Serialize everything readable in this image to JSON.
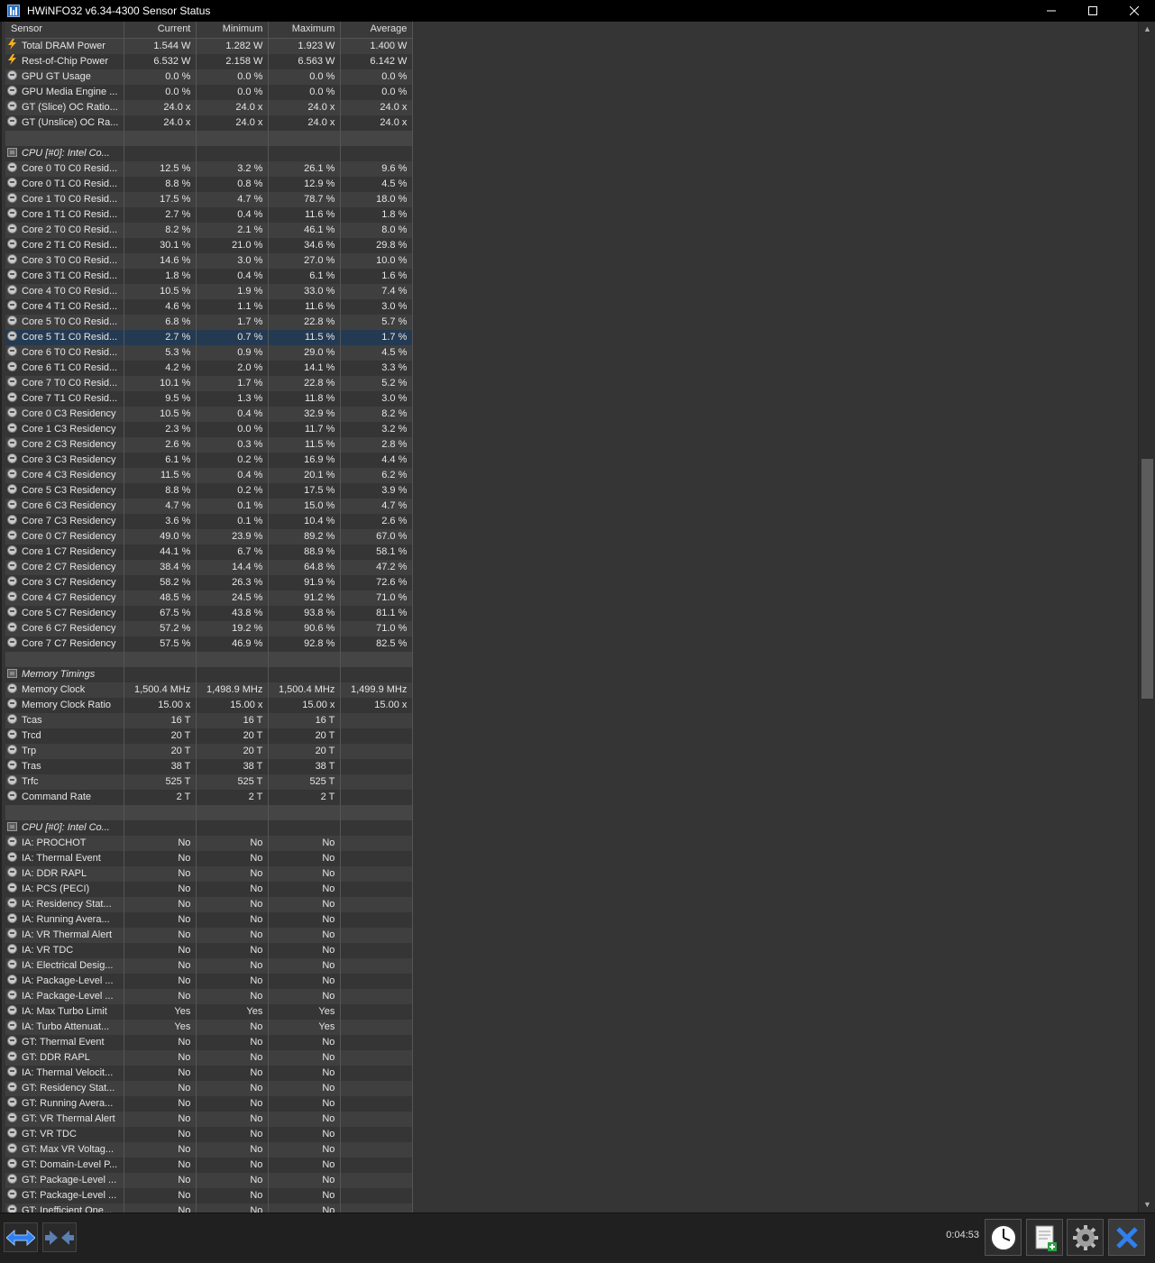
{
  "window": {
    "title": "HWiNFO32 v6.34-4300 Sensor Status",
    "minimize": "minimize",
    "maximize": "maximize",
    "close": "close"
  },
  "columns": [
    "Sensor",
    "Current",
    "Minimum",
    "Maximum",
    "Average"
  ],
  "rows": [
    {
      "icon": "bolt",
      "name": "Total DRAM Power",
      "vals": [
        "1.544 W",
        "1.282 W",
        "1.923 W",
        "1.400 W"
      ]
    },
    {
      "icon": "bolt",
      "name": "Rest-of-Chip Power",
      "vals": [
        "6.532 W",
        "2.158 W",
        "6.563 W",
        "6.142 W"
      ]
    },
    {
      "icon": "gauge",
      "name": "GPU GT Usage",
      "vals": [
        "0.0 %",
        "0.0 %",
        "0.0 %",
        "0.0 %"
      ]
    },
    {
      "icon": "gauge",
      "name": "GPU Media Engine ...",
      "vals": [
        "0.0 %",
        "0.0 %",
        "0.0 %",
        "0.0 %"
      ]
    },
    {
      "icon": "gauge",
      "name": "GT (Slice) OC Ratio...",
      "vals": [
        "24.0 x",
        "24.0 x",
        "24.0 x",
        "24.0 x"
      ]
    },
    {
      "icon": "gauge",
      "name": "GT (Unslice) OC Ra...",
      "vals": [
        "24.0 x",
        "24.0 x",
        "24.0 x",
        "24.0 x"
      ]
    },
    {
      "type": "empty"
    },
    {
      "type": "group",
      "icon": "chip",
      "name": "CPU [#0]: Intel Co..."
    },
    {
      "icon": "gauge",
      "name": "Core 0 T0 C0 Resid...",
      "vals": [
        "12.5 %",
        "3.2 %",
        "26.1 %",
        "9.6 %"
      ]
    },
    {
      "icon": "gauge",
      "name": "Core 0 T1 C0 Resid...",
      "vals": [
        "8.8 %",
        "0.8 %",
        "12.9 %",
        "4.5 %"
      ]
    },
    {
      "icon": "gauge",
      "name": "Core 1 T0 C0 Resid...",
      "vals": [
        "17.5 %",
        "4.7 %",
        "78.7 %",
        "18.0 %"
      ]
    },
    {
      "icon": "gauge",
      "name": "Core 1 T1 C0 Resid...",
      "vals": [
        "2.7 %",
        "0.4 %",
        "11.6 %",
        "1.8 %"
      ]
    },
    {
      "icon": "gauge",
      "name": "Core 2 T0 C0 Resid...",
      "vals": [
        "8.2 %",
        "2.1 %",
        "46.1 %",
        "8.0 %"
      ]
    },
    {
      "icon": "gauge",
      "name": "Core 2 T1 C0 Resid...",
      "vals": [
        "30.1 %",
        "21.0 %",
        "34.6 %",
        "29.8 %"
      ]
    },
    {
      "icon": "gauge",
      "name": "Core 3 T0 C0 Resid...",
      "vals": [
        "14.6 %",
        "3.0 %",
        "27.0 %",
        "10.0 %"
      ]
    },
    {
      "icon": "gauge",
      "name": "Core 3 T1 C0 Resid...",
      "vals": [
        "1.8 %",
        "0.4 %",
        "6.1 %",
        "1.6 %"
      ]
    },
    {
      "icon": "gauge",
      "name": "Core 4 T0 C0 Resid...",
      "vals": [
        "10.5 %",
        "1.9 %",
        "33.0 %",
        "7.4 %"
      ]
    },
    {
      "icon": "gauge",
      "name": "Core 4 T1 C0 Resid...",
      "vals": [
        "4.6 %",
        "1.1 %",
        "11.6 %",
        "3.0 %"
      ]
    },
    {
      "icon": "gauge",
      "name": "Core 5 T0 C0 Resid...",
      "vals": [
        "6.8 %",
        "1.7 %",
        "22.8 %",
        "5.7 %"
      ]
    },
    {
      "icon": "gauge",
      "name": "Core 5 T1 C0 Resid...",
      "vals": [
        "2.7 %",
        "0.7 %",
        "11.5 %",
        "1.7 %"
      ],
      "selected": true
    },
    {
      "icon": "gauge",
      "name": "Core 6 T0 C0 Resid...",
      "vals": [
        "5.3 %",
        "0.9 %",
        "29.0 %",
        "4.5 %"
      ]
    },
    {
      "icon": "gauge",
      "name": "Core 6 T1 C0 Resid...",
      "vals": [
        "4.2 %",
        "2.0 %",
        "14.1 %",
        "3.3 %"
      ]
    },
    {
      "icon": "gauge",
      "name": "Core 7 T0 C0 Resid...",
      "vals": [
        "10.1 %",
        "1.7 %",
        "22.8 %",
        "5.2 %"
      ]
    },
    {
      "icon": "gauge",
      "name": "Core 7 T1 C0 Resid...",
      "vals": [
        "9.5 %",
        "1.3 %",
        "11.8 %",
        "3.0 %"
      ]
    },
    {
      "icon": "gauge",
      "name": "Core 0 C3 Residency",
      "vals": [
        "10.5 %",
        "0.4 %",
        "32.9 %",
        "8.2 %"
      ]
    },
    {
      "icon": "gauge",
      "name": "Core 1 C3 Residency",
      "vals": [
        "2.3 %",
        "0.0 %",
        "11.7 %",
        "3.2 %"
      ]
    },
    {
      "icon": "gauge",
      "name": "Core 2 C3 Residency",
      "vals": [
        "2.6 %",
        "0.3 %",
        "11.5 %",
        "2.8 %"
      ]
    },
    {
      "icon": "gauge",
      "name": "Core 3 C3 Residency",
      "vals": [
        "6.1 %",
        "0.2 %",
        "16.9 %",
        "4.4 %"
      ]
    },
    {
      "icon": "gauge",
      "name": "Core 4 C3 Residency",
      "vals": [
        "11.5 %",
        "0.4 %",
        "20.1 %",
        "6.2 %"
      ]
    },
    {
      "icon": "gauge",
      "name": "Core 5 C3 Residency",
      "vals": [
        "8.8 %",
        "0.2 %",
        "17.5 %",
        "3.9 %"
      ]
    },
    {
      "icon": "gauge",
      "name": "Core 6 C3 Residency",
      "vals": [
        "4.7 %",
        "0.1 %",
        "15.0 %",
        "4.7 %"
      ]
    },
    {
      "icon": "gauge",
      "name": "Core 7 C3 Residency",
      "vals": [
        "3.6 %",
        "0.1 %",
        "10.4 %",
        "2.6 %"
      ]
    },
    {
      "icon": "gauge",
      "name": "Core 0 C7 Residency",
      "vals": [
        "49.0 %",
        "23.9 %",
        "89.2 %",
        "67.0 %"
      ]
    },
    {
      "icon": "gauge",
      "name": "Core 1 C7 Residency",
      "vals": [
        "44.1 %",
        "6.7 %",
        "88.9 %",
        "58.1 %"
      ]
    },
    {
      "icon": "gauge",
      "name": "Core 2 C7 Residency",
      "vals": [
        "38.4 %",
        "14.4 %",
        "64.8 %",
        "47.2 %"
      ]
    },
    {
      "icon": "gauge",
      "name": "Core 3 C7 Residency",
      "vals": [
        "58.2 %",
        "26.3 %",
        "91.9 %",
        "72.6 %"
      ]
    },
    {
      "icon": "gauge",
      "name": "Core 4 C7 Residency",
      "vals": [
        "48.5 %",
        "24.5 %",
        "91.2 %",
        "71.0 %"
      ]
    },
    {
      "icon": "gauge",
      "name": "Core 5 C7 Residency",
      "vals": [
        "67.5 %",
        "43.8 %",
        "93.8 %",
        "81.1 %"
      ]
    },
    {
      "icon": "gauge",
      "name": "Core 6 C7 Residency",
      "vals": [
        "57.2 %",
        "19.2 %",
        "90.6 %",
        "71.0 %"
      ]
    },
    {
      "icon": "gauge",
      "name": "Core 7 C7 Residency",
      "vals": [
        "57.5 %",
        "46.9 %",
        "92.8 %",
        "82.5 %"
      ]
    },
    {
      "type": "empty"
    },
    {
      "type": "group",
      "icon": "chip",
      "name": "Memory Timings"
    },
    {
      "icon": "gauge",
      "name": "Memory Clock",
      "vals": [
        "1,500.4 MHz",
        "1,498.9 MHz",
        "1,500.4 MHz",
        "1,499.9 MHz"
      ]
    },
    {
      "icon": "gauge",
      "name": "Memory Clock Ratio",
      "vals": [
        "15.00 x",
        "15.00 x",
        "15.00 x",
        "15.00 x"
      ]
    },
    {
      "icon": "gauge",
      "name": "Tcas",
      "vals": [
        "16 T",
        "16 T",
        "16 T",
        ""
      ]
    },
    {
      "icon": "gauge",
      "name": "Trcd",
      "vals": [
        "20 T",
        "20 T",
        "20 T",
        ""
      ]
    },
    {
      "icon": "gauge",
      "name": "Trp",
      "vals": [
        "20 T",
        "20 T",
        "20 T",
        ""
      ]
    },
    {
      "icon": "gauge",
      "name": "Tras",
      "vals": [
        "38 T",
        "38 T",
        "38 T",
        ""
      ]
    },
    {
      "icon": "gauge",
      "name": "Trfc",
      "vals": [
        "525 T",
        "525 T",
        "525 T",
        ""
      ]
    },
    {
      "icon": "gauge",
      "name": "Command Rate",
      "vals": [
        "2 T",
        "2 T",
        "2 T",
        ""
      ]
    },
    {
      "type": "empty"
    },
    {
      "type": "group",
      "icon": "chip",
      "name": "CPU [#0]: Intel Co..."
    },
    {
      "icon": "gauge",
      "name": "IA: PROCHOT",
      "vals": [
        "No",
        "No",
        "No",
        ""
      ]
    },
    {
      "icon": "gauge",
      "name": "IA: Thermal Event",
      "vals": [
        "No",
        "No",
        "No",
        ""
      ]
    },
    {
      "icon": "gauge",
      "name": "IA: DDR RAPL",
      "vals": [
        "No",
        "No",
        "No",
        ""
      ]
    },
    {
      "icon": "gauge",
      "name": "IA: PCS (PECI)",
      "vals": [
        "No",
        "No",
        "No",
        ""
      ]
    },
    {
      "icon": "gauge",
      "name": "IA: Residency Stat...",
      "vals": [
        "No",
        "No",
        "No",
        ""
      ]
    },
    {
      "icon": "gauge",
      "name": "IA: Running Avera...",
      "vals": [
        "No",
        "No",
        "No",
        ""
      ]
    },
    {
      "icon": "gauge",
      "name": "IA: VR Thermal Alert",
      "vals": [
        "No",
        "No",
        "No",
        ""
      ]
    },
    {
      "icon": "gauge",
      "name": "IA: VR TDC",
      "vals": [
        "No",
        "No",
        "No",
        ""
      ]
    },
    {
      "icon": "gauge",
      "name": "IA: Electrical Desig...",
      "vals": [
        "No",
        "No",
        "No",
        ""
      ]
    },
    {
      "icon": "gauge",
      "name": "IA: Package-Level ...",
      "vals": [
        "No",
        "No",
        "No",
        ""
      ]
    },
    {
      "icon": "gauge",
      "name": "IA: Package-Level ...",
      "vals": [
        "No",
        "No",
        "No",
        ""
      ]
    },
    {
      "icon": "gauge",
      "name": "IA: Max Turbo Limit",
      "vals": [
        "Yes",
        "Yes",
        "Yes",
        ""
      ]
    },
    {
      "icon": "gauge",
      "name": "IA: Turbo Attenuat...",
      "vals": [
        "Yes",
        "No",
        "Yes",
        ""
      ]
    },
    {
      "icon": "gauge",
      "name": "GT: Thermal Event",
      "vals": [
        "No",
        "No",
        "No",
        ""
      ]
    },
    {
      "icon": "gauge",
      "name": "GT: DDR RAPL",
      "vals": [
        "No",
        "No",
        "No",
        ""
      ]
    },
    {
      "icon": "gauge",
      "name": "IA: Thermal Velocit...",
      "vals": [
        "No",
        "No",
        "No",
        ""
      ]
    },
    {
      "icon": "gauge",
      "name": "GT: Residency Stat...",
      "vals": [
        "No",
        "No",
        "No",
        ""
      ]
    },
    {
      "icon": "gauge",
      "name": "GT: Running Avera...",
      "vals": [
        "No",
        "No",
        "No",
        ""
      ]
    },
    {
      "icon": "gauge",
      "name": "GT: VR Thermal Alert",
      "vals": [
        "No",
        "No",
        "No",
        ""
      ]
    },
    {
      "icon": "gauge",
      "name": "GT: VR TDC",
      "vals": [
        "No",
        "No",
        "No",
        ""
      ]
    },
    {
      "icon": "gauge",
      "name": "GT: Max VR Voltag...",
      "vals": [
        "No",
        "No",
        "No",
        ""
      ]
    },
    {
      "icon": "gauge",
      "name": "GT: Domain-Level P...",
      "vals": [
        "No",
        "No",
        "No",
        ""
      ]
    },
    {
      "icon": "gauge",
      "name": "GT: Package-Level ...",
      "vals": [
        "No",
        "No",
        "No",
        ""
      ]
    },
    {
      "icon": "gauge",
      "name": "GT: Package-Level ...",
      "vals": [
        "No",
        "No",
        "No",
        ""
      ]
    },
    {
      "icon": "gauge",
      "name": "GT: Inefficient One...",
      "vals": [
        "No",
        "No",
        "No",
        ""
      ]
    }
  ],
  "bottom": {
    "timer": "0:04:53",
    "buttons": [
      "nav-expand-icon",
      "nav-collapse-icon",
      "clock-icon",
      "report-icon",
      "settings-gear-icon",
      "close-x-icon"
    ]
  },
  "colors": {
    "background": "#353535",
    "row_alt": "#3f3f3f",
    "selected_row": "#243a52",
    "accent_blue": "#2f80ed",
    "bolt": "#f2b01e"
  }
}
